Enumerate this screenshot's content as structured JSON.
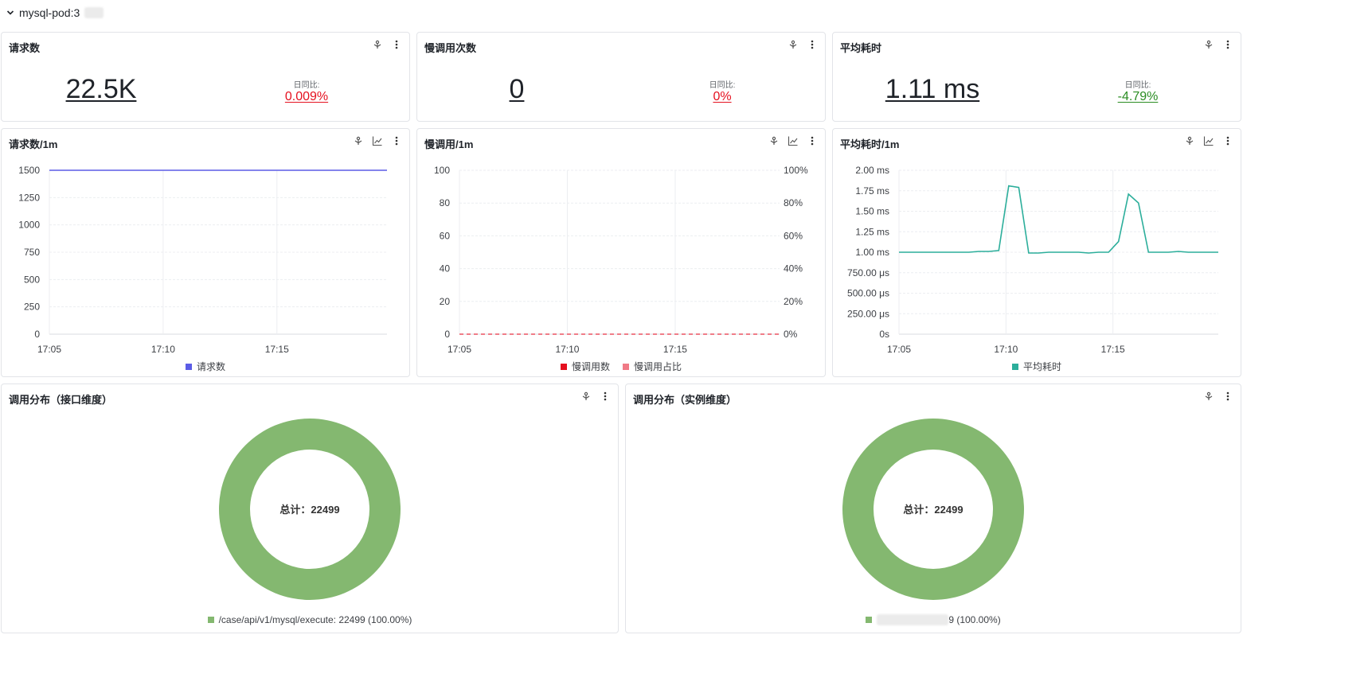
{
  "group": {
    "title": "mysql-pod:3"
  },
  "colors": {
    "up": "#e5101f",
    "down": "#2a8c22",
    "requests": "#5b5ce6",
    "slow": "#e5101f",
    "slow_ratio": "#f07a86",
    "latency": "#2cae9b",
    "donut": "#84b870"
  },
  "stats": [
    {
      "title": "请求数",
      "value": "22.5K",
      "compare_label": "日同比:",
      "compare_value": "0.009%"
    },
    {
      "title": "慢调用次数",
      "value": "0",
      "compare_label": "日同比:",
      "compare_value": "0%"
    },
    {
      "title": "平均耗时",
      "value": "1.11 ms",
      "compare_label": "日同比:",
      "compare_value": "-4.79%"
    }
  ],
  "chart_data": [
    {
      "type": "line",
      "title": "请求数/1m",
      "xlabels": [
        "17:05",
        "17:10",
        "17:15"
      ],
      "yticks": [
        "0",
        "250",
        "500",
        "750",
        "1000",
        "1250",
        "1500"
      ],
      "ylim": [
        0,
        1500
      ],
      "series": [
        {
          "name": "请求数",
          "values": [
            1500,
            1500,
            1500,
            1500,
            1500,
            1500,
            1500,
            1500,
            1500,
            1500,
            1500,
            1500,
            1500,
            1500,
            1500
          ]
        }
      ]
    },
    {
      "type": "line",
      "title": "慢调用/1m",
      "xlabels": [
        "17:05",
        "17:10",
        "17:15"
      ],
      "yticks": [
        "0",
        "20",
        "40",
        "60",
        "80",
        "100"
      ],
      "yticks_right": [
        "0%",
        "20%",
        "40%",
        "60%",
        "80%",
        "100%"
      ],
      "ylim": [
        0,
        100
      ],
      "series": [
        {
          "name": "慢调用数",
          "values": [
            0,
            0,
            0,
            0,
            0,
            0,
            0,
            0,
            0,
            0,
            0,
            0,
            0,
            0,
            0
          ]
        },
        {
          "name": "慢调用占比",
          "values": [
            0,
            0,
            0,
            0,
            0,
            0,
            0,
            0,
            0,
            0,
            0,
            0,
            0,
            0,
            0
          ]
        }
      ]
    },
    {
      "type": "line",
      "title": "平均耗时/1m",
      "xlabels": [
        "17:05",
        "17:10",
        "17:15"
      ],
      "yticks": [
        "0s",
        "250.00 μs",
        "500.00 μs",
        "750.00 μs",
        "1.00 ms",
        "1.25 ms",
        "1.50 ms",
        "1.75 ms",
        "2.00 ms"
      ],
      "ylim": [
        0,
        2.0
      ],
      "series": [
        {
          "name": "平均耗时",
          "values": [
            1.0,
            1.0,
            1.0,
            1.0,
            1.0,
            1.0,
            1.0,
            1.0,
            1.01,
            1.01,
            1.02,
            1.81,
            1.79,
            0.99,
            0.99,
            1.0,
            1.0,
            1.0,
            1.0,
            0.99,
            1.0,
            1.0,
            1.13,
            1.71,
            1.6,
            1.0,
            1.0,
            1.0,
            1.01,
            1.0,
            1.0,
            1.0,
            1.0
          ]
        }
      ]
    },
    {
      "type": "pie",
      "title": "调用分布（接口维度）",
      "center_label": "总计：22499",
      "slices": [
        {
          "name": "/case/api/v1/mysql/execute",
          "value": 22499,
          "legend": "/case/api/v1/mysql/execute: 22499 (100.00%)"
        }
      ]
    },
    {
      "type": "pie",
      "title": "调用分布（实例维度）",
      "center_label": "总计：22499",
      "slices": [
        {
          "value": 22499,
          "legend": "9 (100.00%)"
        }
      ]
    }
  ]
}
